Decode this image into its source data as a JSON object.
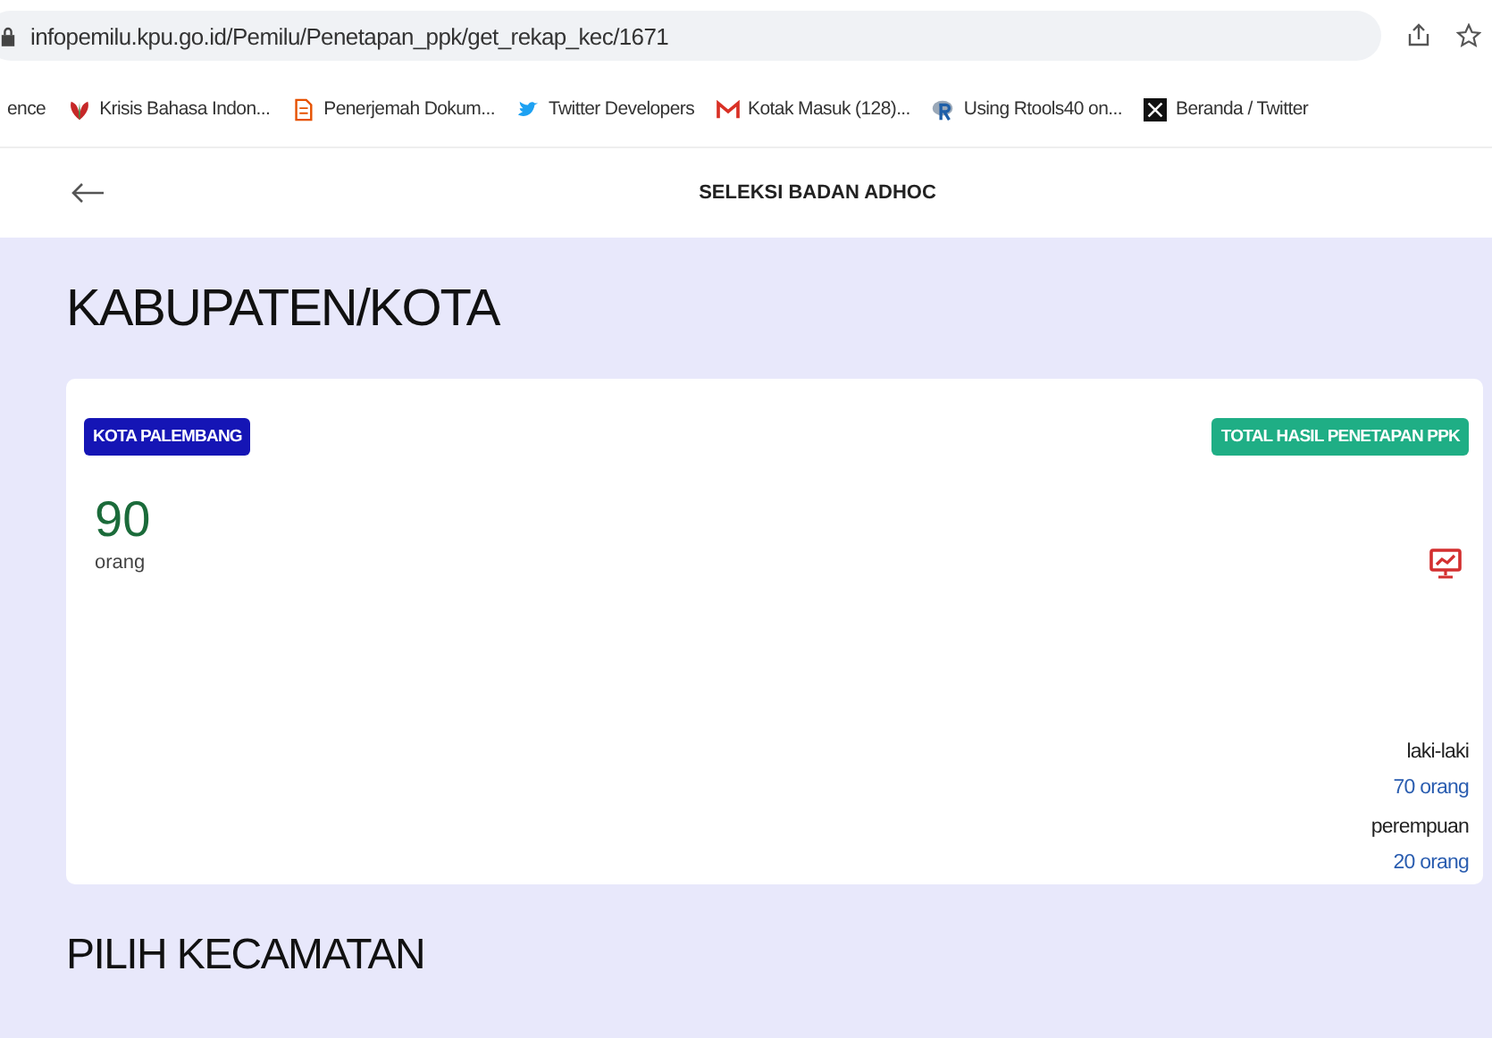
{
  "browser": {
    "url": "infopemilu.kpu.go.id/Pemilu/Penetapan_ppk/get_rekap_kec/1671",
    "bookmarks": [
      {
        "label": "ence"
      },
      {
        "label": "Krisis Bahasa Indon..."
      },
      {
        "label": "Penerjemah Dokum..."
      },
      {
        "label": "Twitter Developers"
      },
      {
        "label": "Kotak Masuk (128)..."
      },
      {
        "label": "Using Rtools40 on..."
      },
      {
        "label": "Beranda / Twitter"
      }
    ]
  },
  "header": {
    "title": "SELEKSI BADAN ADHOC"
  },
  "heading": "KABUPATEN/KOTA",
  "card": {
    "region": "KOTA PALEMBANG",
    "total_label": "TOTAL HASIL PENETAPAN PPK",
    "total": "90",
    "total_unit": "orang",
    "breakdown": [
      {
        "label": "laki-laki",
        "value": "70 orang"
      },
      {
        "label": "perempuan",
        "value": "20 orang"
      }
    ]
  },
  "section_heading": "PILIH KECAMATAN"
}
